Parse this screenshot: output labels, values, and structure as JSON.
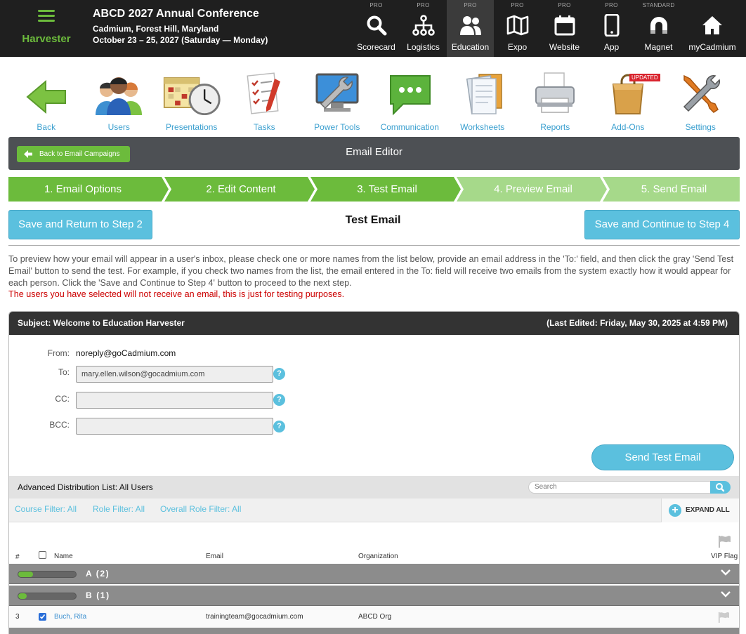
{
  "header": {
    "brand": "Harvester",
    "conference_title": "ABCD 2027 Annual Conference",
    "location": "Cadmium, Forest Hill, Maryland",
    "dates": "October 23 – 25, 2027 (Saturday — Monday)"
  },
  "topnav": [
    {
      "tier": "PRO",
      "label": "Scorecard",
      "icon": "search-icon"
    },
    {
      "tier": "PRO",
      "label": "Logistics",
      "icon": "sitemap-icon"
    },
    {
      "tier": "PRO",
      "label": "Education",
      "icon": "users-icon",
      "active": true
    },
    {
      "tier": "PRO",
      "label": "Expo",
      "icon": "map-icon"
    },
    {
      "tier": "PRO",
      "label": "Website",
      "icon": "calendar-icon"
    },
    {
      "tier": "PRO",
      "label": "App",
      "icon": "mobile-icon"
    },
    {
      "tier": "STANDARD",
      "label": "Magnet",
      "icon": "magnet-icon"
    },
    {
      "tier": "",
      "label": "myCadmium",
      "icon": "home-icon"
    }
  ],
  "toolbar": [
    {
      "label": "Back",
      "icon": "back-arrow-icon"
    },
    {
      "label": "Users",
      "icon": "users-group-icon"
    },
    {
      "label": "Presentations",
      "icon": "calendar-clock-icon"
    },
    {
      "label": "Tasks",
      "icon": "checklist-icon"
    },
    {
      "label": "Power Tools",
      "icon": "monitor-wrench-icon"
    },
    {
      "label": "Communication",
      "icon": "chat-bubble-icon"
    },
    {
      "label": "Worksheets",
      "icon": "documents-icon"
    },
    {
      "label": "Reports",
      "icon": "printer-icon"
    },
    {
      "label": "Add-Ons",
      "icon": "shopping-bag-icon",
      "badge": "UPDATED"
    },
    {
      "label": "Settings",
      "icon": "tools-icon"
    }
  ],
  "editor": {
    "back_label": "Back to Email Campaigns",
    "title": "Email Editor"
  },
  "steps": [
    {
      "label": "1. Email Options",
      "state": "done"
    },
    {
      "label": "2. Edit Content",
      "state": "done"
    },
    {
      "label": "3. Test Email",
      "state": "current"
    },
    {
      "label": "4. Preview Email",
      "state": "todo"
    },
    {
      "label": "5. Send Email",
      "state": "todo"
    }
  ],
  "step_nav": {
    "prev_label": "Save and Return to Step 2",
    "heading": "Test Email",
    "next_label": "Save and Continue to Step 4"
  },
  "instructions": "To preview how your email will appear in a user's inbox, please check one or more names from the list below, provide an email address in the 'To:' field, and then click the gray 'Send Test Email' button to send the test. For example, if you check two names from the list, the email entered in the To: field will receive two emails from the system exactly how it would appear for each person. Click the 'Save and Continue to Step 4' button to proceed to the next step.",
  "warning": "The users you have selected will not receive an email, this is just for testing purposes.",
  "email": {
    "subject": "Subject: Welcome to Education Harvester",
    "last_edited": "(Last Edited: Friday, May 30, 2025 at 4:59 PM)",
    "from_label": "From:",
    "from_value": "noreply@goCadmium.com",
    "to_label": "To:",
    "to_value": "mary.ellen.wilson@gocadmium.com",
    "cc_label": "CC:",
    "cc_value": "",
    "bcc_label": "BCC:",
    "bcc_value": "",
    "help": "?",
    "send_label": "Send Test Email"
  },
  "distribution": {
    "title": "Advanced Distribution List: All Users",
    "search_placeholder": "Search",
    "filters": [
      "Course Filter: All",
      "Role Filter: All",
      "Overall Role Filter: All"
    ],
    "expand_all": "EXPAND ALL",
    "columns": {
      "num": "#",
      "name": "Name",
      "email": "Email",
      "org": "Organization",
      "vip": "VIP Flag"
    },
    "groups": [
      {
        "label": "A (2)",
        "progress": 0.25
      },
      {
        "label": "B (1)",
        "progress": 0.15
      }
    ],
    "rows": [
      {
        "num": "3",
        "checked": true,
        "name": "Buch, Rita",
        "email": "trainingteam@gocadmium.com",
        "org": "ABCD Org"
      }
    ]
  },
  "colors": {
    "green": "#6cbb3c",
    "green_light": "#a6d98a",
    "blue": "#5bc0de",
    "dark": "#1f1f1f",
    "warning": "#cc0000"
  }
}
